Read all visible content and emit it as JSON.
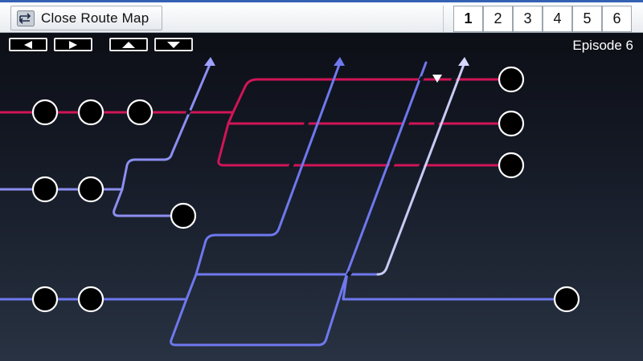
{
  "toolbar": {
    "close_label": "Close Route Map",
    "close_icon": "route-map-icon"
  },
  "tabs": [
    "1",
    "2",
    "3",
    "4",
    "5",
    "6"
  ],
  "active_tab": "1",
  "nav": [
    "left-arrow-icon",
    "right-arrow-icon",
    "up-arrow-icon",
    "down-arrow-icon"
  ],
  "episode_label": "Episode 6",
  "colors": {
    "red_route": "#d11557",
    "blue_route": "#6f78ee",
    "lavender_route": "#8c8ef0",
    "white_route": "#c8cbf5",
    "node_fill": "#000000",
    "node_stroke": "#ffffff"
  }
}
